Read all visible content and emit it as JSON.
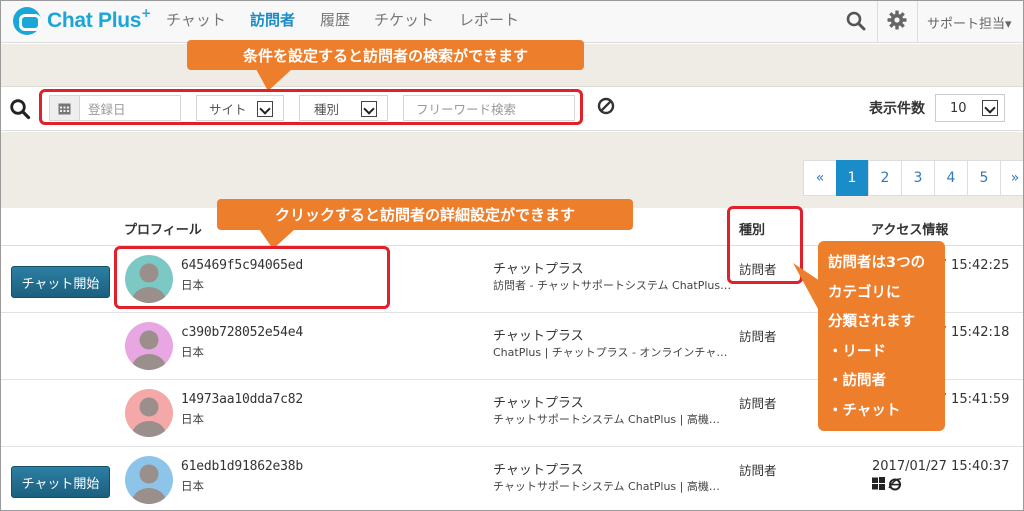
{
  "app": {
    "name": "Chat Plus",
    "name_sup": "+"
  },
  "nav": {
    "items": [
      {
        "label": "チャット",
        "active": false
      },
      {
        "label": "訪問者",
        "active": true
      },
      {
        "label": "履歴",
        "active": false
      },
      {
        "label": "チケット",
        "active": false
      },
      {
        "label": "レポート",
        "active": false
      }
    ],
    "user_menu": "サポート担当▾"
  },
  "filters": {
    "date_placeholder": "登録日",
    "site_label": "サイト",
    "type_label": "種別",
    "keyword_placeholder": "フリーワード検索",
    "per_page_label": "表示件数",
    "per_page_value": "10"
  },
  "pagination": [
    "«",
    "1",
    "2",
    "3",
    "4",
    "5",
    "»"
  ],
  "pagination_active": "1",
  "table": {
    "headers": {
      "profile": "プロフィール",
      "type": "種別",
      "access": "アクセス情報"
    },
    "rows": [
      {
        "chat_button": "チャット開始",
        "visitor_id": "645469f5c94065ed",
        "country": "日本",
        "site": "チャットプラス",
        "page": "訪問者 - チャットサポートシステム ChatPlus…",
        "type": "訪問者",
        "access_time": "2017/01/27 15:42:25",
        "avatar_color": "#7cc8c4"
      },
      {
        "chat_button": "",
        "visitor_id": "c390b728052e54e4",
        "country": "日本",
        "site": "チャットプラス",
        "page": "ChatPlus | チャットプラス - オンラインチャ…",
        "type": "訪問者",
        "access_time": "2017/01/27 15:42:18",
        "avatar_color": "#e8a6e2"
      },
      {
        "chat_button": "",
        "visitor_id": "14973aa10dda7c82",
        "country": "日本",
        "site": "チャットプラス",
        "page": "チャットサポートシステム ChatPlus | 高機…",
        "type": "訪問者",
        "access_time": "2017/01/27 15:41:59",
        "avatar_color": "#f4a8a8"
      },
      {
        "chat_button": "チャット開始",
        "visitor_id": "61edb1d91862e38b",
        "country": "日本",
        "site": "チャットプラス",
        "page": "チャットサポートシステム ChatPlus | 高機…",
        "type": "訪問者",
        "access_time": "2017/01/27 15:40:37",
        "avatar_color": "#8cc4ea"
      }
    ]
  },
  "annotations": {
    "filter_callout": "条件を設定すると訪問者の検索ができます",
    "profile_callout": "クリックすると訪問者の詳細設定ができます",
    "category_lines": [
      "訪問者は3つの",
      "カテゴリに",
      "分類されます",
      "・リード",
      "・訪問者",
      "・チャット"
    ]
  },
  "colors": {
    "brand": "#1aa7d8",
    "nav_active": "#1a8cc7",
    "callout": "#ec7e2c",
    "highlight": "#e0202a",
    "chat_button": "#1c5f7e"
  }
}
